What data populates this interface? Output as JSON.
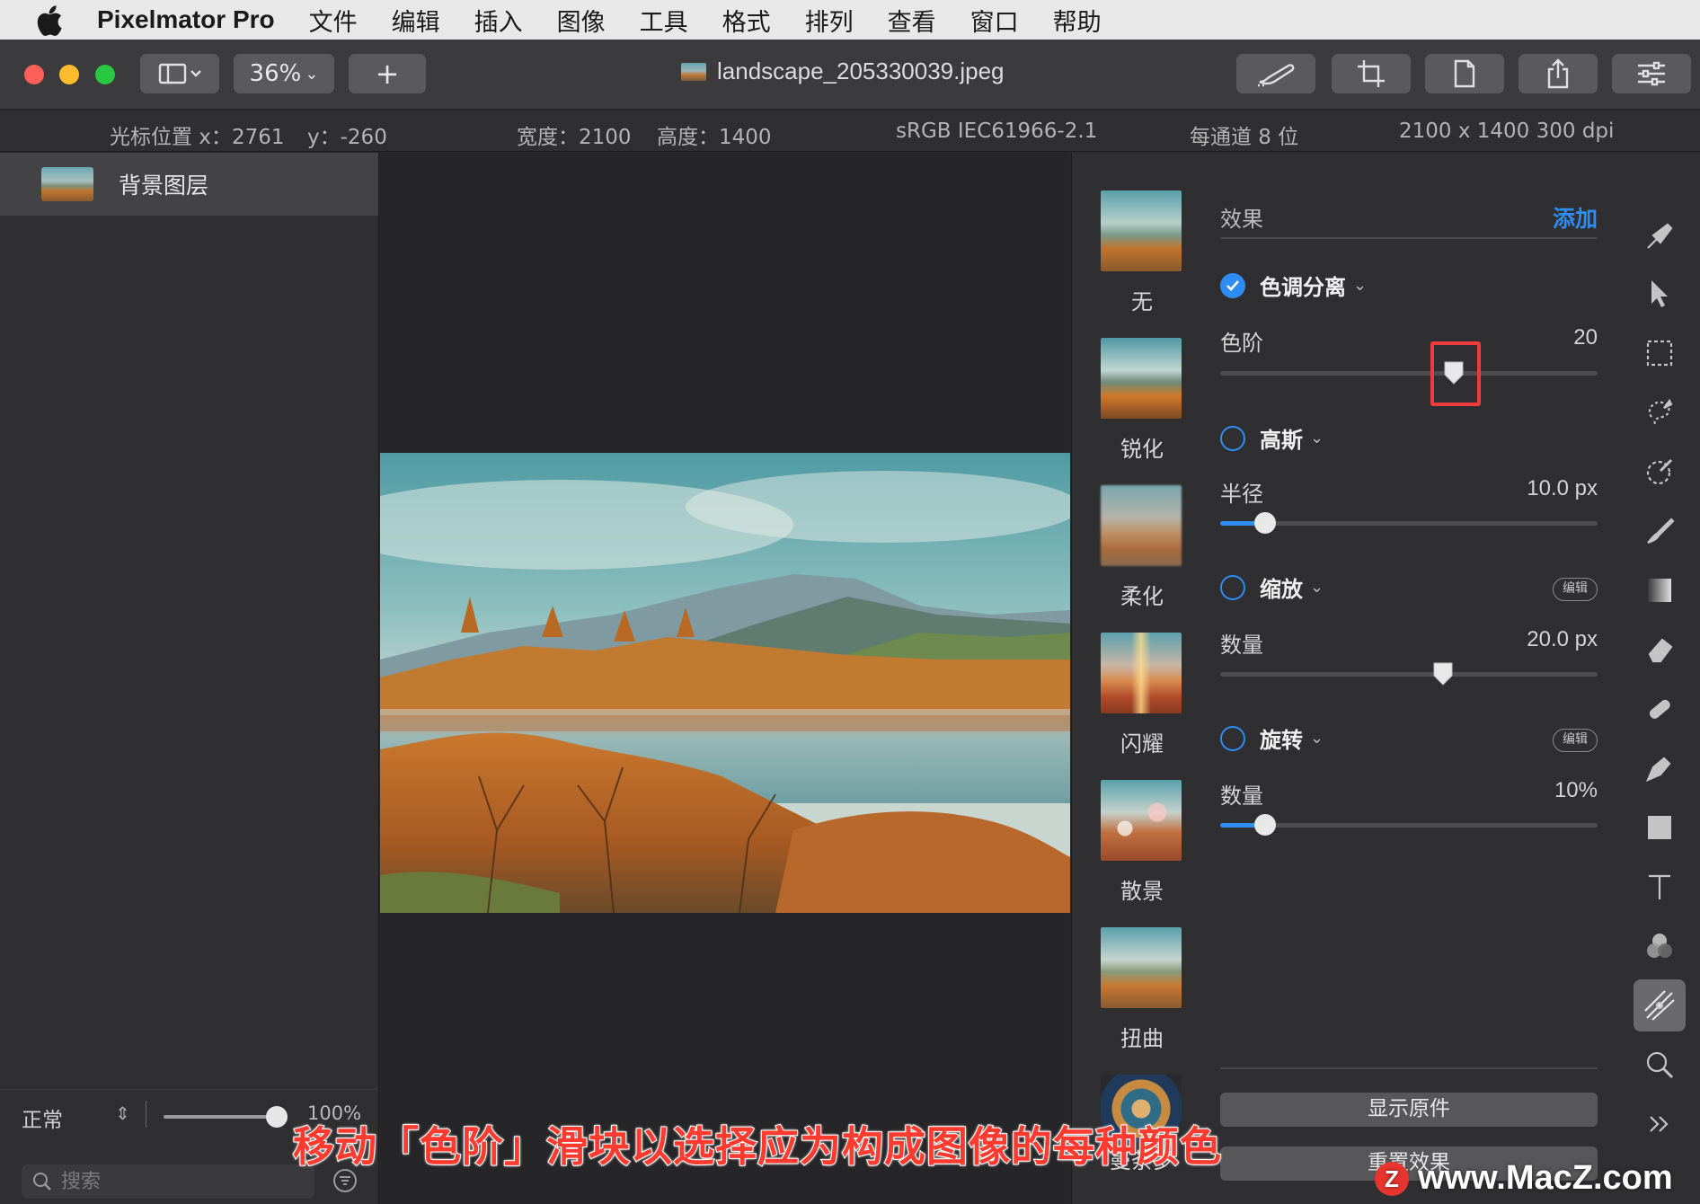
{
  "menubar": {
    "app_name": "Pixelmator Pro",
    "items": [
      "文件",
      "编辑",
      "插入",
      "图像",
      "工具",
      "格式",
      "排列",
      "查看",
      "窗口",
      "帮助"
    ]
  },
  "toolbar": {
    "zoom": "36%",
    "add_label": "+",
    "document_title": "landscape_205330039.jpeg"
  },
  "infobar": {
    "cursor_x_label": "光标位置 x：",
    "cursor_x": "2761",
    "cursor_y_label": "y：",
    "cursor_y": "-260",
    "width_label": "宽度：",
    "width": "2100",
    "height_label": "高度：",
    "height": "1400",
    "color_profile": "sRGB IEC61966-2.1",
    "bit_depth": "每通道 8 位",
    "dimensions": "2100 x 1400 300 dpi"
  },
  "layers": {
    "items": [
      {
        "name": "背景图层"
      }
    ],
    "blend_mode": "正常",
    "opacity": "100%",
    "opacity_fraction": 1.0,
    "search_placeholder": "搜索"
  },
  "effects_browser": {
    "items": [
      "无",
      "锐化",
      "柔化",
      "闪耀",
      "散景",
      "扭曲",
      "曼荼罗"
    ]
  },
  "effects_panel": {
    "header": "效果",
    "add_label": "添加",
    "edit_label": "编辑",
    "effects": [
      {
        "name": "色调分离",
        "enabled": true,
        "param_label": "色阶",
        "param_value": "20",
        "slider_fraction": 0.62
      },
      {
        "name": "高斯",
        "enabled": false,
        "param_label": "半径",
        "param_value": "10.0 px",
        "slider_fraction": 0.12
      },
      {
        "name": "缩放",
        "enabled": false,
        "param_label": "数量",
        "param_value": "20.0 px",
        "slider_fraction": 0.59
      },
      {
        "name": "旋转",
        "enabled": false,
        "param_label": "数量",
        "param_value": "10%",
        "slider_fraction": 0.12
      }
    ],
    "show_original_label": "显示原件",
    "reset_label": "重置效果"
  },
  "overlay": {
    "caption": "移动「色阶」滑块以选择应为构成图像的每种颜色",
    "watermark": "www.MacZ.com",
    "watermark_logo": "Z"
  },
  "colors": {
    "accent": "#2f8cf3",
    "highlight": "#ee3b3b",
    "traffic_red": "#fe5f57",
    "traffic_yellow": "#febc2e",
    "traffic_green": "#28c840"
  }
}
